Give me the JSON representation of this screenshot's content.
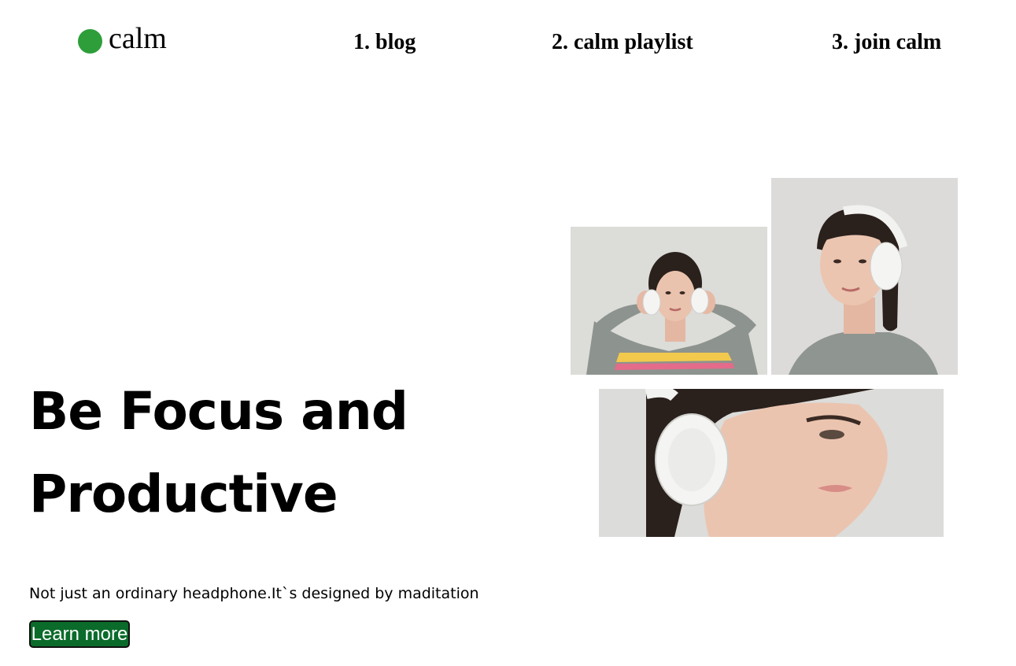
{
  "brand": {
    "name": "calm",
    "dot_color": "#2e9e3a"
  },
  "nav": {
    "items": [
      {
        "label": "1. blog"
      },
      {
        "label": "2. calm playlist"
      },
      {
        "label": "3. join calm"
      }
    ]
  },
  "hero": {
    "headline_line1": "Be Focus and",
    "headline_line2": "Productive",
    "tagline": "Not just an ordinary headphone.It`s designed by maditation",
    "cta_label": "Learn more",
    "cta_color": "#0a6b2a"
  },
  "gallery": {
    "images": [
      {
        "subject": "woman-holding-headphones-photo"
      },
      {
        "subject": "woman-headphones-side-profile-photo"
      },
      {
        "subject": "woman-headphones-closeup-photo"
      }
    ]
  }
}
